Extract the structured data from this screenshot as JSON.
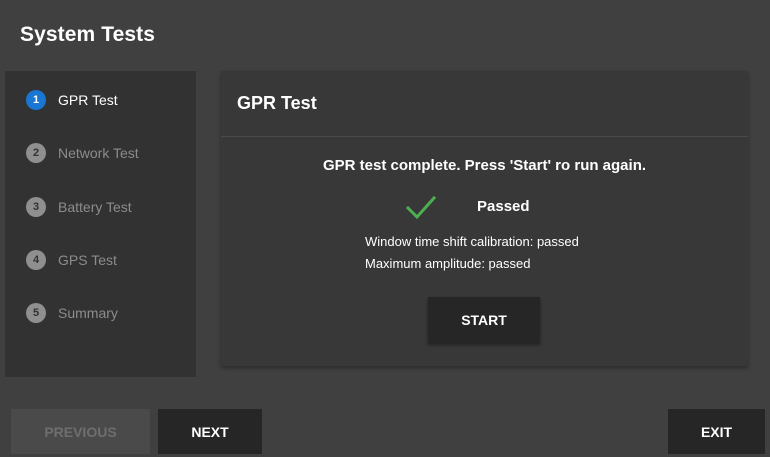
{
  "window": {
    "title": "System Tests"
  },
  "stepper": {
    "active_step": 1,
    "steps": [
      {
        "number": "1",
        "label": "GPR Test"
      },
      {
        "number": "2",
        "label": "Network Test"
      },
      {
        "number": "3",
        "label": "Battery Test"
      },
      {
        "number": "4",
        "label": "GPS Test"
      },
      {
        "number": "5",
        "label": "Summary"
      }
    ]
  },
  "card": {
    "header": "GPR Test",
    "status_message": "GPR test complete. Press 'Start' ro run again.",
    "result_icon": "check-icon",
    "result_label": "Passed",
    "details": [
      "Window time shift calibration: passed",
      "Maximum amplitude: passed"
    ],
    "start_label": "START"
  },
  "footer": {
    "previous_label": "PREVIOUS",
    "next_label": "NEXT",
    "exit_label": "EXIT"
  },
  "colors": {
    "background": "#404040",
    "panel": "#323232",
    "card": "#383838",
    "accent_blue": "#1976d2",
    "success_green": "#4caf50",
    "button_dark": "#262626"
  }
}
